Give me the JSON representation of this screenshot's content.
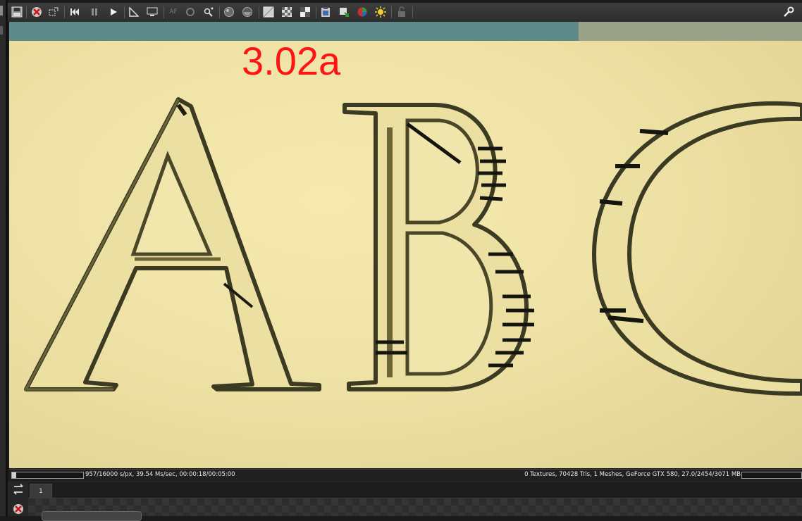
{
  "toolbar": {
    "icons": [
      "save-render-icon",
      "cancel-render-icon",
      "region-render-icon",
      "rewind-icon",
      "pause-icon",
      "play-icon",
      "ruler-icon",
      "monitor-icon",
      "af-icon",
      "refresh-icon",
      "focus-picker-icon",
      "material-sphere-icon",
      "material-sphere-alt-icon",
      "alpha-display-icon",
      "checker-display-icon",
      "contrast-display-icon",
      "clipboard-icon",
      "export-icon",
      "color-picker-icon",
      "light-icon",
      "lock-icon"
    ],
    "af_label": "AF",
    "settings_icon": "wrench-icon"
  },
  "viewport": {
    "version_label": "3.02a",
    "letters": "ABC"
  },
  "status": {
    "left_text": "957/16000 s/px, 39.54 Ms/sec, 00:00:18/00:05:00",
    "right_text": "0 Textures, 70428 Tris, 1 Meshes, GeForce GTX 580, 27.0/2454/3071 MB",
    "render_progress": 0.06,
    "memory_progress": 0.0
  },
  "bottom_panel": {
    "tab_label": "1",
    "icons": [
      "graph-layout-icon",
      "cancel-node-icon"
    ]
  },
  "colors": {
    "label_red": "#ff1414",
    "background_cream": "#efe2a6"
  }
}
